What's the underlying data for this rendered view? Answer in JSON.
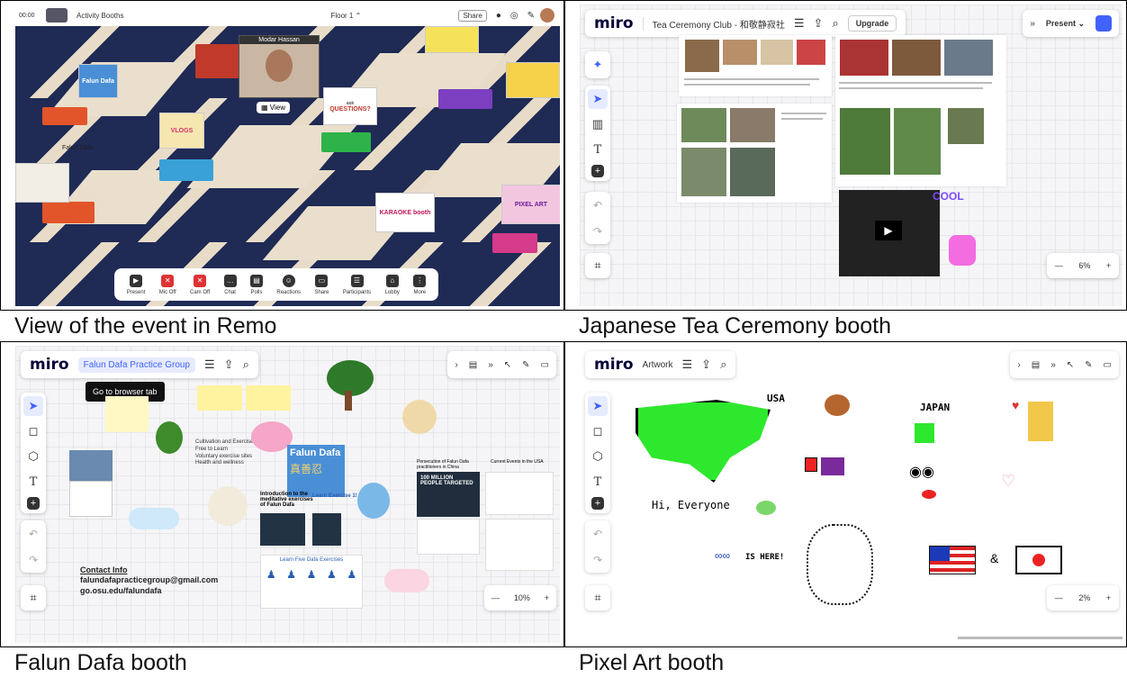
{
  "captions": {
    "remo": "View of the event in Remo",
    "tea": "Japanese Tea Ceremony booth",
    "falun": "Falun Dafa booth",
    "pixel": "Pixel Art booth"
  },
  "remo": {
    "room": "Activity Booths",
    "floor": "Floor 1",
    "timer": "00:00",
    "share": "Share",
    "user_name": "Modar Hassan",
    "view_label": "View",
    "posters": {
      "falun": "Falun Dafa",
      "falun_label": "Falun Dafa",
      "questions": "QUESTIONS?",
      "questions_small": "ask",
      "vlogs": "VLOGS",
      "karaoke": "KARAOKE booth",
      "pixel": "PIXEL ART"
    },
    "toolbar": [
      "Present",
      "Mic Off",
      "Cam Off",
      "Chat",
      "Polls",
      "Reactions",
      "Share",
      "Participants",
      "Lobby",
      "More"
    ]
  },
  "tea": {
    "logo": "miro",
    "board": "Tea Ceremony Club - 和敬静寂社",
    "upgrade": "Upgrade",
    "present": "Present",
    "zoom": "6%",
    "sticker": "COOL"
  },
  "falun": {
    "logo": "miro",
    "board": "Falun Dafa Practice Group",
    "tooltip": "Go to browser tab",
    "zoom": "10%",
    "title": "Falun Dafa",
    "chars": "真善忍",
    "contact_title": "Contact Info",
    "contact_email": "falundafapracticegroup@gmail.com",
    "contact_url": "go.osu.edu/falundafa",
    "intro": "Introduction to the meditative exercises of Falun Dafa",
    "learn": "Learn Exercise 1!",
    "learn5": "Learn Five Dafa Exercises",
    "stat": "100 MILLION PEOPLE TARGETED",
    "bullets": [
      "Cultivation and Exercise",
      "Free to Learn",
      "Voluntary exercise sites",
      "Health and wellness"
    ],
    "persecution": "Persecution of Falun Dafa practitioners in China",
    "events": "Current Events in the USA"
  },
  "pixel": {
    "logo": "miro",
    "board": "Artwork",
    "zoom": "2%",
    "usa": "USA",
    "japan": "JAPAN",
    "hi": "Hi, Everyone",
    "here": "IS HERE!",
    "amp": "&"
  }
}
